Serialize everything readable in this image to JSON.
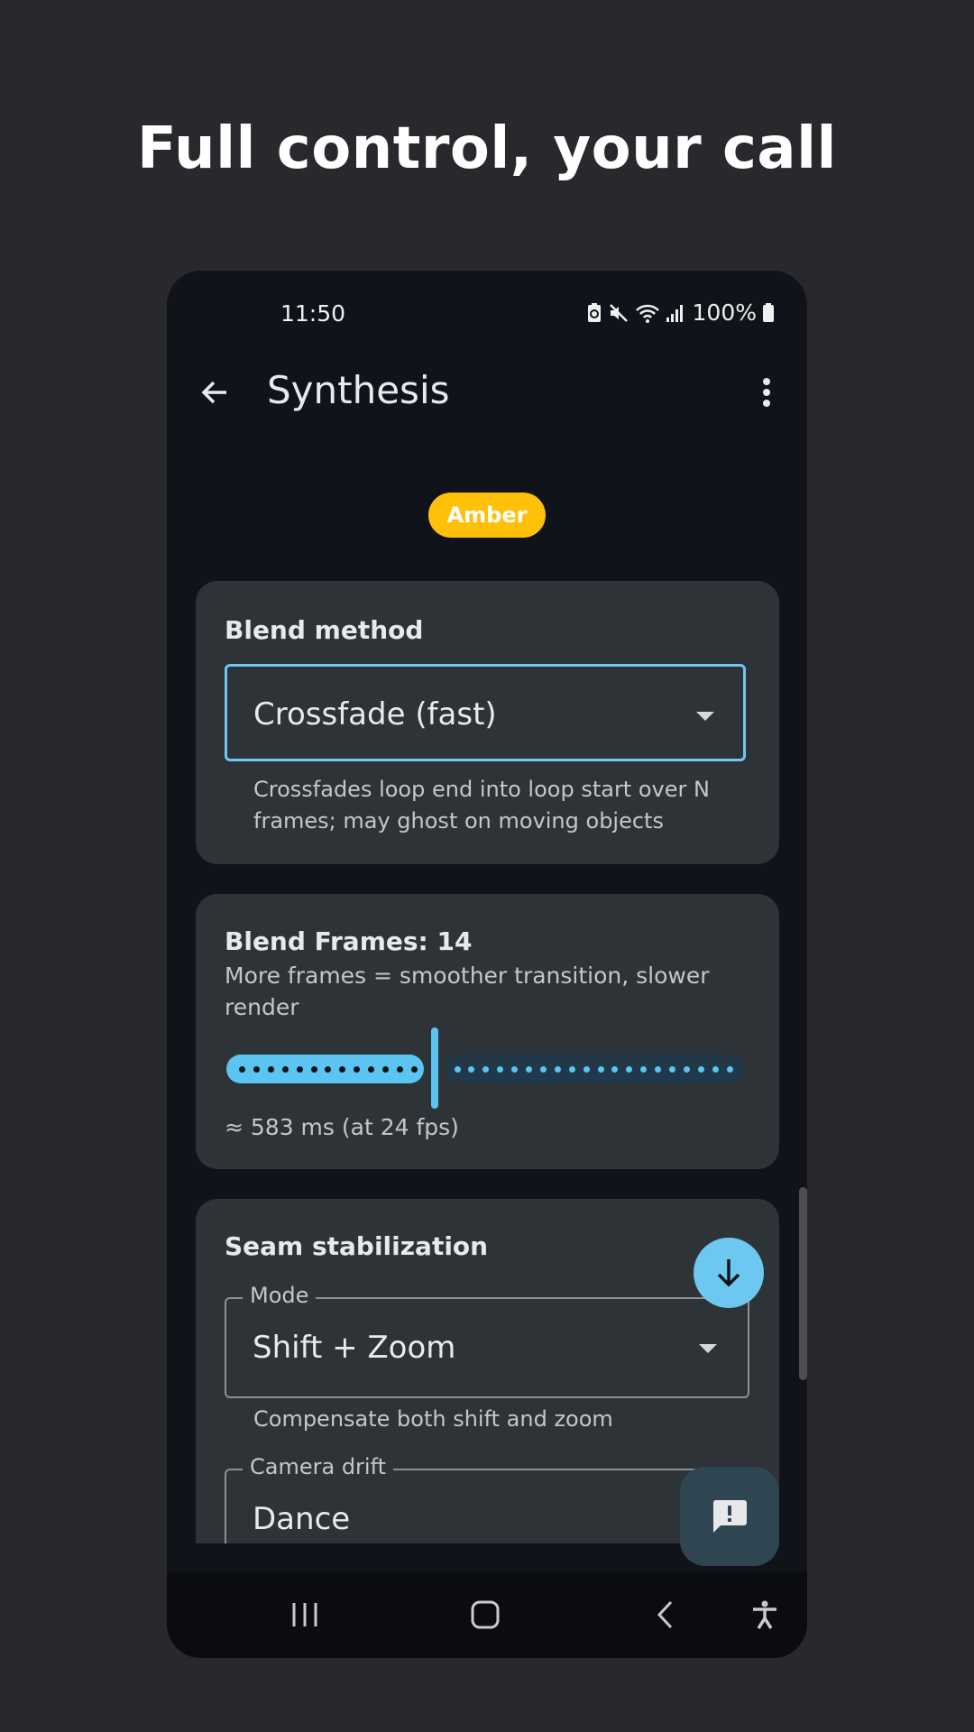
{
  "headline": "Full control, your call",
  "status_bar": {
    "time": "11:50",
    "battery_percent": "100%",
    "icons": [
      "battery-saver-icon",
      "mute-icon",
      "wifi-icon",
      "signal-icon",
      "battery-icon"
    ]
  },
  "app_bar": {
    "title": "Synthesis",
    "back_icon": "arrow-back-icon",
    "menu_icon": "more-vert-icon"
  },
  "profile_chip": {
    "label": "Amber",
    "color": "#ffc107"
  },
  "blend_method": {
    "title": "Blend method",
    "selected": "Crossfade (fast)",
    "helper": "Crossfades loop end into loop start over N frames; may ghost on moving objects"
  },
  "blend_frames": {
    "title": "Blend Frames: 14",
    "subtitle": "More frames = smoother transition, slower render",
    "slider_value_fraction": 0.41,
    "duration_text": "≈ 583 ms  (at 24 fps)"
  },
  "seam_stabilization": {
    "title": "Seam stabilization",
    "mode_label": "Mode",
    "mode_value": "Shift + Zoom",
    "mode_helper": "Compensate both shift and zoom",
    "drift_label": "Camera drift",
    "drift_value": "Dance"
  },
  "fabs": {
    "scroll_down_icon": "arrow-down-icon",
    "feedback_icon": "feedback-icon"
  },
  "nav_bar": [
    "recents-icon",
    "home-icon",
    "back-icon",
    "accessibility-icon"
  ],
  "colors": {
    "accent": "#6cc8f0",
    "background": "#10141a",
    "card": "#2e3338"
  }
}
